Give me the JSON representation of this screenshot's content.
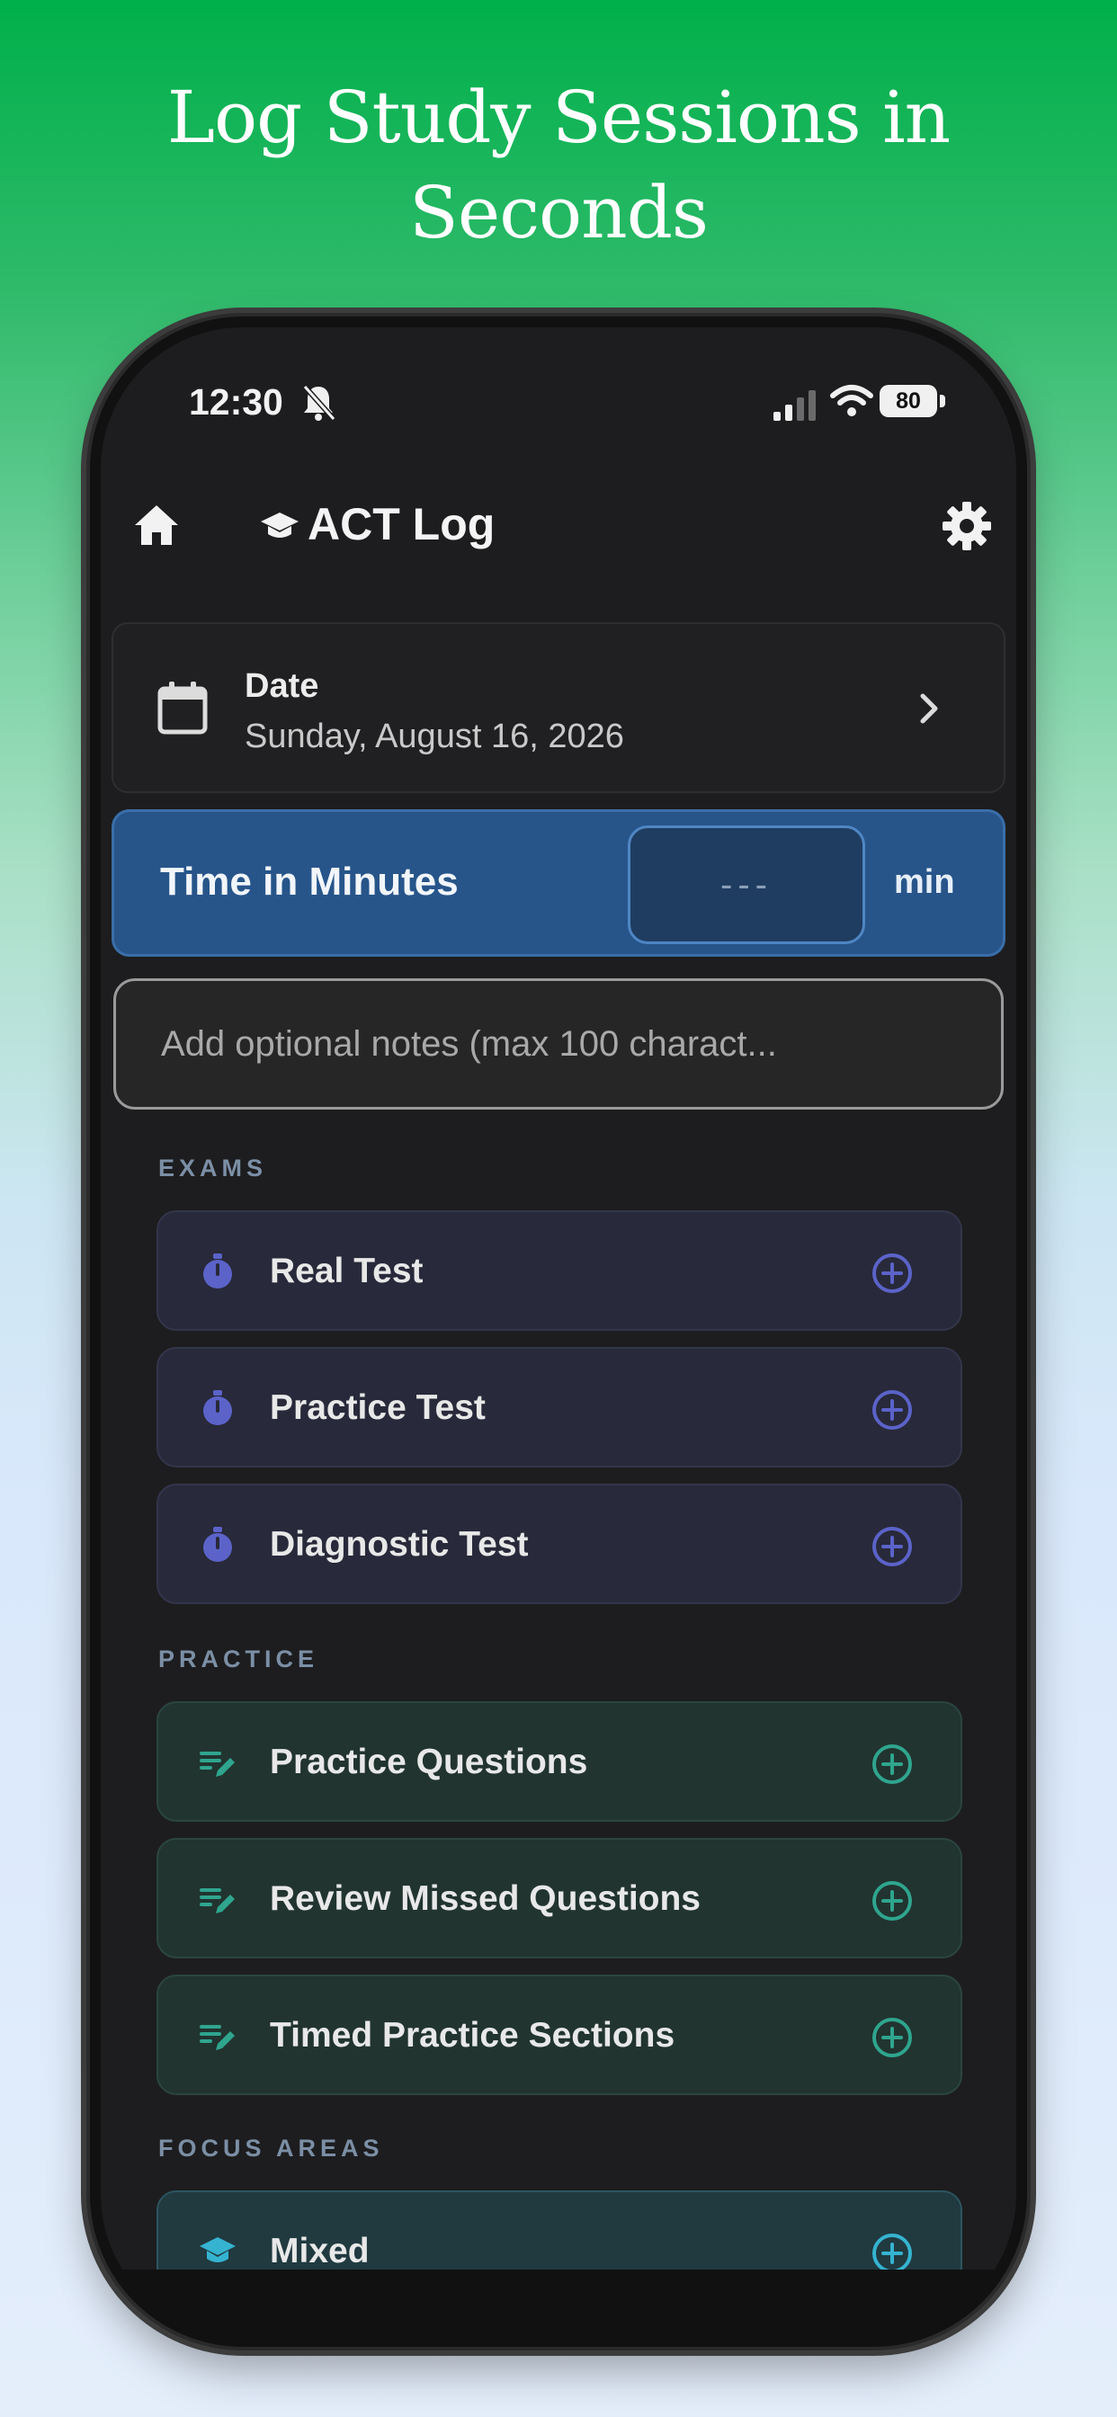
{
  "headline": {
    "line1": "Log Study Sessions in",
    "line2": "Seconds"
  },
  "status_bar": {
    "time": "12:30",
    "battery": "80"
  },
  "app_bar": {
    "title": "ACT Log"
  },
  "date_card": {
    "label": "Date",
    "value": "Sunday, August 16, 2026"
  },
  "time_card": {
    "label": "Time in Minutes",
    "placeholder": "---",
    "unit": "min"
  },
  "notes": {
    "placeholder": "Add optional notes (max 100 charact..."
  },
  "sections": {
    "exams": {
      "title": "EXAMS",
      "items": [
        {
          "label": "Real Test",
          "icon": "stopwatch-icon"
        },
        {
          "label": "Practice Test",
          "icon": "stopwatch-icon"
        },
        {
          "label": "Diagnostic Test",
          "icon": "stopwatch-icon"
        }
      ]
    },
    "practice": {
      "title": "PRACTICE",
      "items": [
        {
          "label": "Practice Questions",
          "icon": "edit-list-icon"
        },
        {
          "label": "Review Missed Questions",
          "icon": "edit-list-icon"
        },
        {
          "label": "Timed Practice Sections",
          "icon": "edit-list-icon"
        }
      ]
    },
    "focus": {
      "title": "FOCUS AREAS",
      "items": [
        {
          "label": "Mixed",
          "icon": "graduation-cap-icon"
        }
      ]
    }
  },
  "colors": {
    "exam_accent": "#5b63c9",
    "practice_accent": "#2fa58e",
    "focus_accent": "#35b3d0",
    "time_card_bg": "#27558a"
  }
}
